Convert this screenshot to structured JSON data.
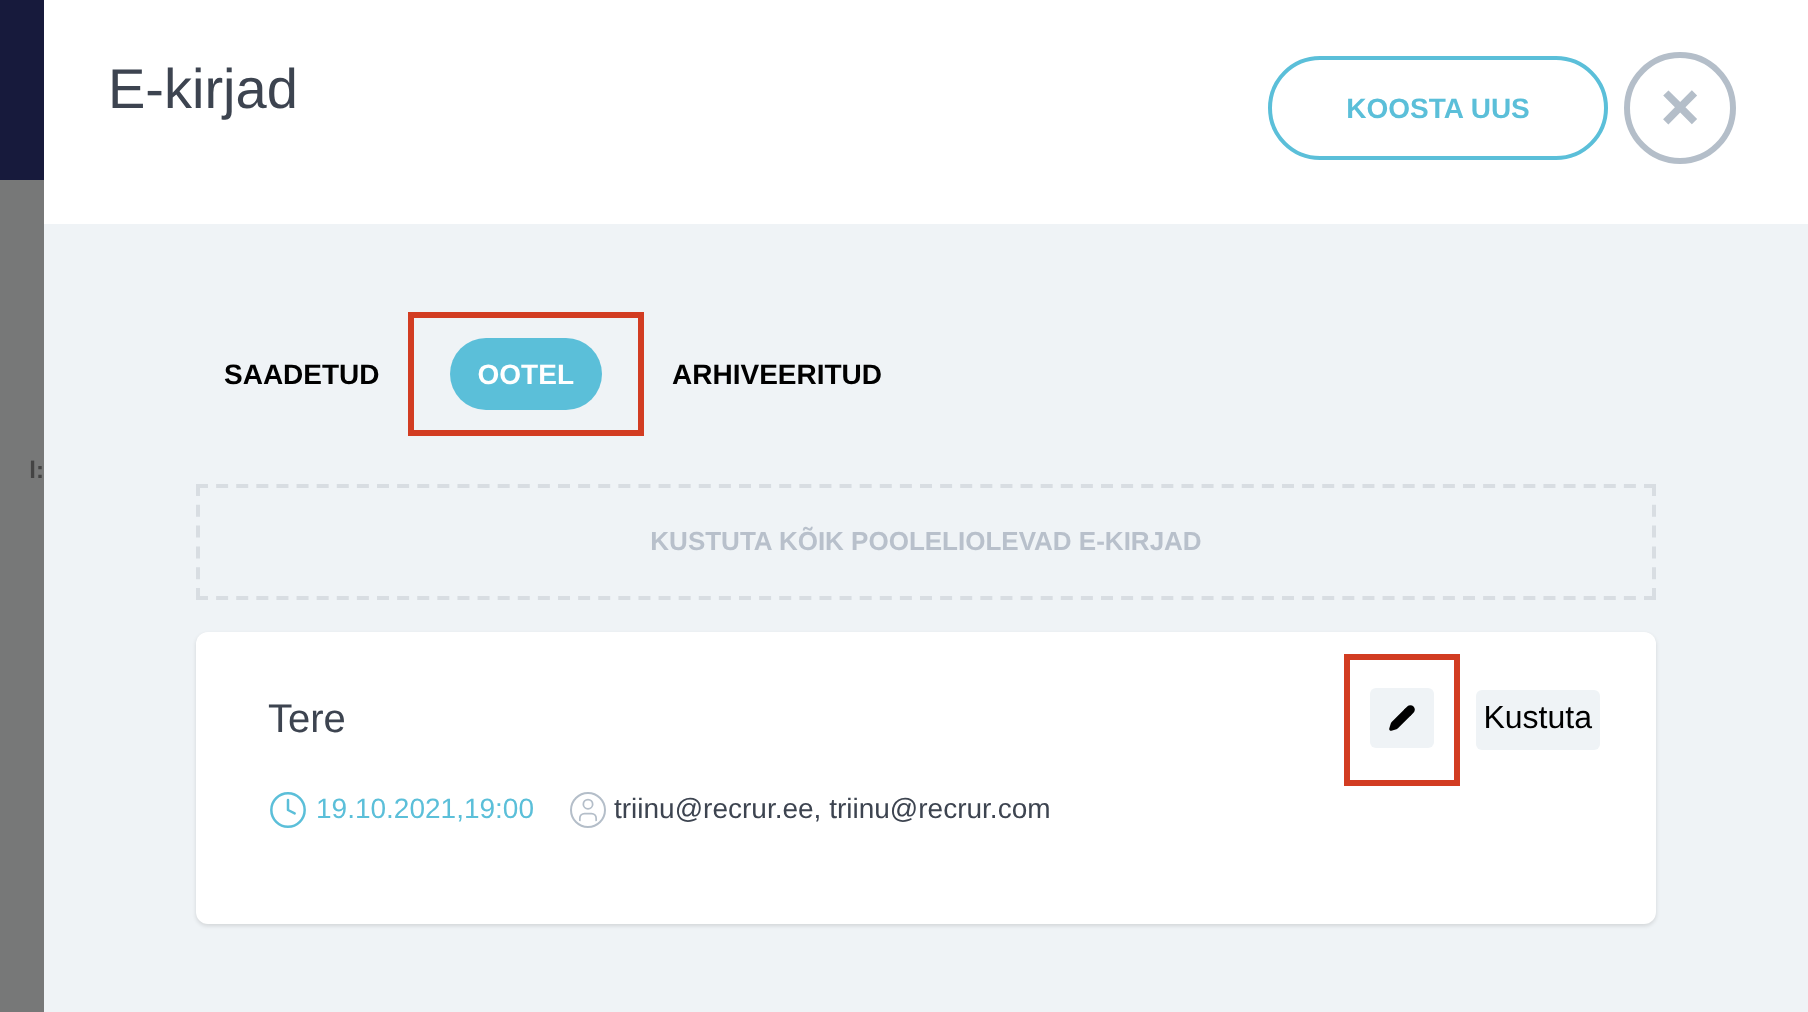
{
  "backdrop": {
    "text": "l:"
  },
  "title": "E-kirjad",
  "header_buttons": {
    "compose": "KOOSTA UUS",
    "close": "×"
  },
  "tabs": [
    {
      "label": "SAADETUD",
      "selected": false,
      "highlighted": false
    },
    {
      "label": "OOTEL",
      "selected": true,
      "highlighted": true
    },
    {
      "label": "ARHIVEERITUD",
      "selected": false,
      "highlighted": false
    }
  ],
  "delete_all": "KUSTUTA KÕIK POOLELIOLEVAD E-KIRJAD",
  "emails": [
    {
      "subject": "Tere",
      "time": "19.10.2021,19:00",
      "recipients": "triinu@recrur.ee, triinu@recrur.com",
      "edit_highlighted": true,
      "delete": "Kustuta"
    }
  ]
}
